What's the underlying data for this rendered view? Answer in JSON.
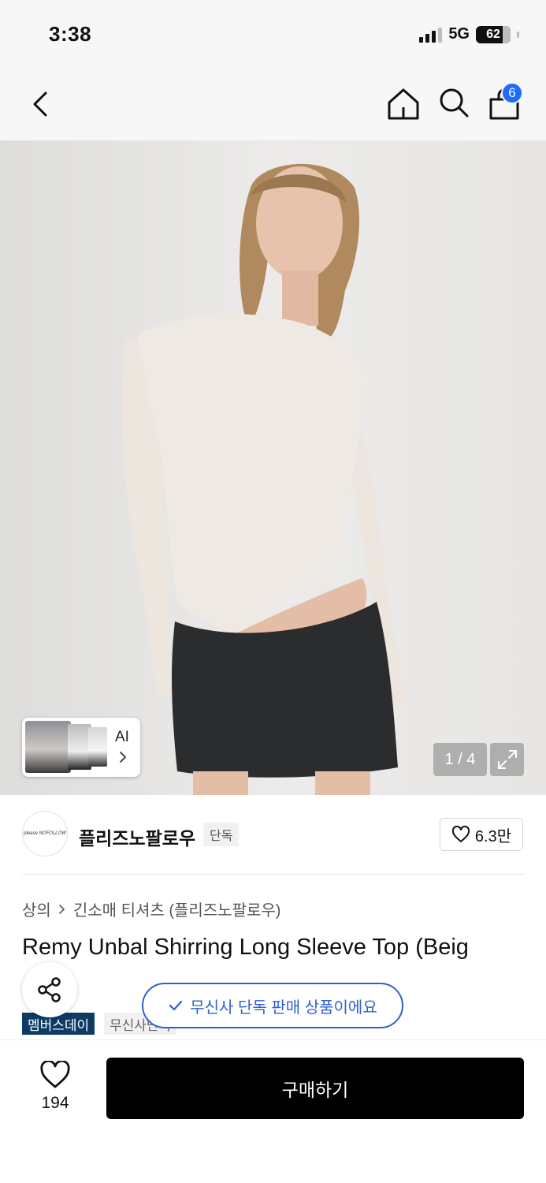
{
  "status": {
    "time": "3:38",
    "network": "5G",
    "battery": "62"
  },
  "nav": {
    "cart_count": "6"
  },
  "gallery": {
    "ai_label": "AI",
    "counter": "1 / 4"
  },
  "brand": {
    "logo_text": "please NOFOLLOW",
    "name": "플리즈노팔로우",
    "tag": "단독",
    "likes": "6.3만"
  },
  "product": {
    "breadcrumb": [
      "상의",
      "긴소매 티셔츠 (플리즈노팔로우)"
    ],
    "title": "Remy Unbal Shirring Long Sleeve Top (Beig",
    "exclusive_notice": "무신사 단독 판매 상품이에요",
    "tags": [
      "멤버스데이",
      "무신사단독"
    ]
  },
  "bottom": {
    "like_count": "194",
    "buy_label": "구매하기"
  },
  "colors": {
    "accent_blue": "#2f5fd0",
    "badge_blue": "#1f6bff",
    "member_tag": "#0d3b66"
  }
}
